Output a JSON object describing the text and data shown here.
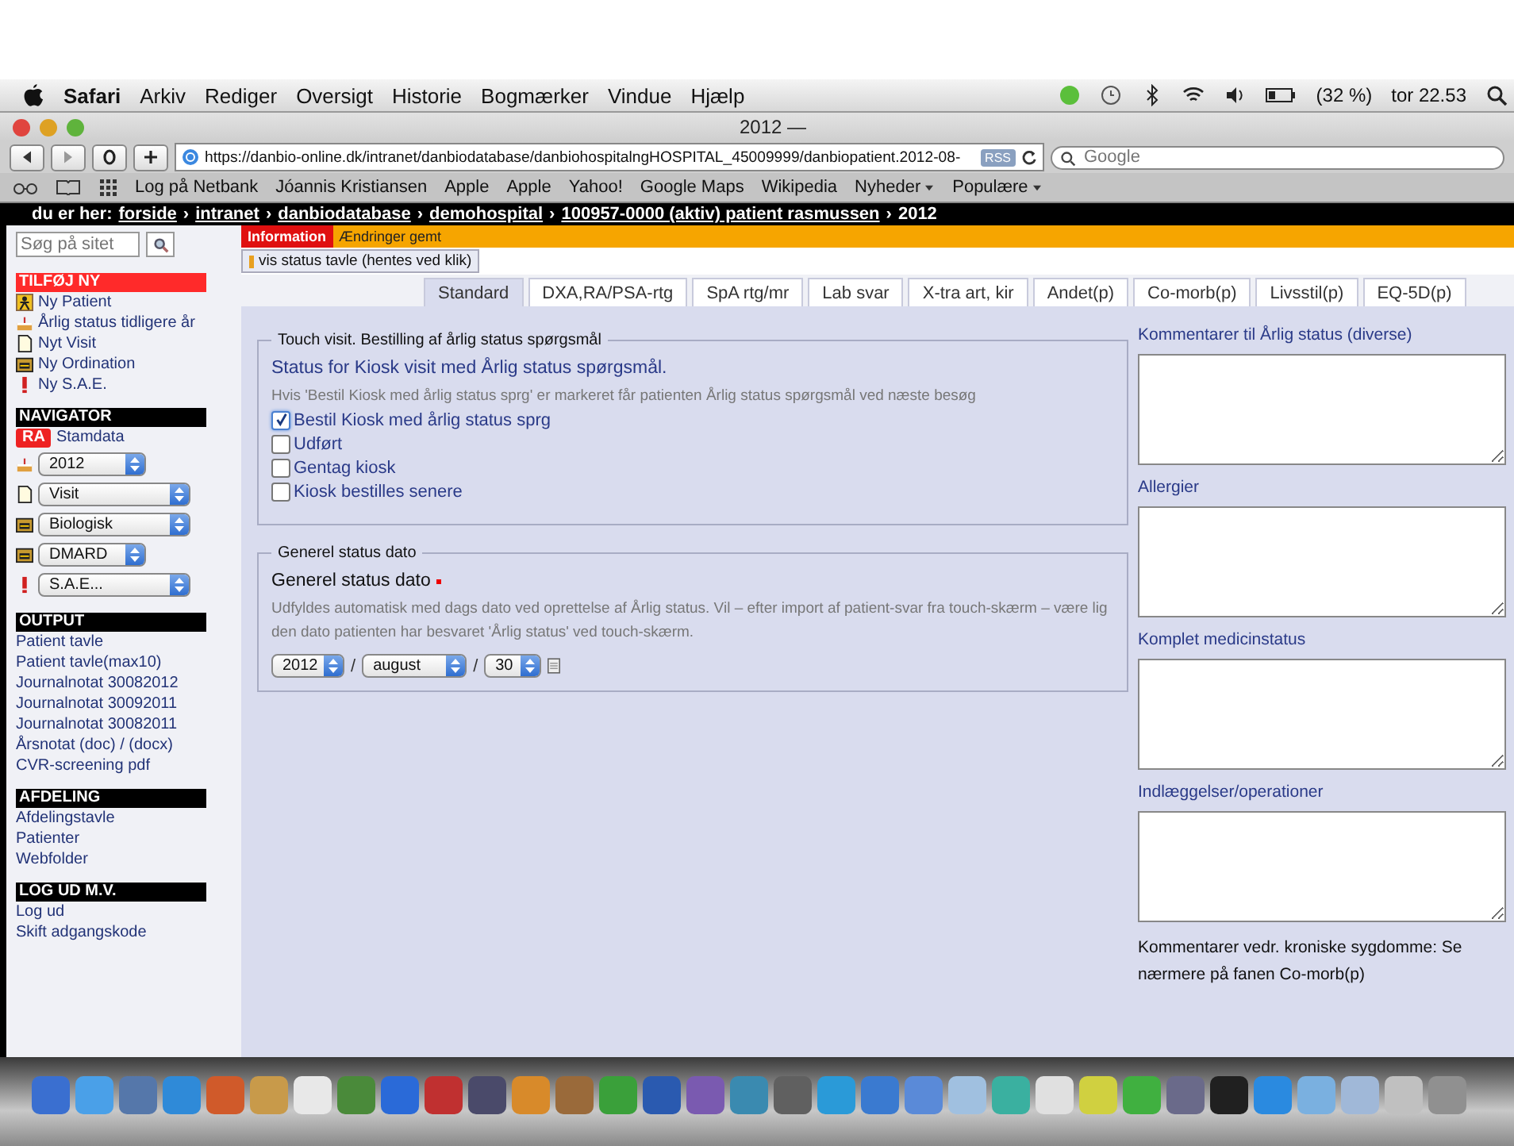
{
  "menu_bar": {
    "app": "Safari",
    "items": [
      "Arkiv",
      "Rediger",
      "Oversigt",
      "Historie",
      "Bogmærker",
      "Vindue",
      "Hjælp"
    ],
    "battery": "(32 %)",
    "clock": "tor 22.53"
  },
  "browser": {
    "title": "2012 —",
    "url": "https://danbio-online.dk/intranet/danbiodatabase/danbiohospitalngHOSPITAL_45009999/danbiopatient.2012-08-",
    "rss": "RSS",
    "search_placeholder": "Google",
    "bookmarks": [
      {
        "label": "Log på Netbank",
        "dropdown": false
      },
      {
        "label": "Jóannis Kristiansen",
        "dropdown": false
      },
      {
        "label": "Apple",
        "dropdown": false
      },
      {
        "label": "Apple",
        "dropdown": false
      },
      {
        "label": "Yahoo!",
        "dropdown": false
      },
      {
        "label": "Google Maps",
        "dropdown": false
      },
      {
        "label": "Wikipedia",
        "dropdown": false
      },
      {
        "label": "Nyheder",
        "dropdown": true
      },
      {
        "label": "Populære",
        "dropdown": true
      }
    ]
  },
  "breadcrumb": {
    "prefix": "du er her:",
    "separator": "›",
    "links": [
      "forside",
      "intranet",
      "danbiodatabase",
      "demohospital",
      "100957-0000 (aktiv) patient rasmussen"
    ],
    "current": "2012"
  },
  "sidebar": {
    "search_placeholder": "Søg på sitet",
    "sections": [
      {
        "title": "TILFØJ NY",
        "color": "#ff2a2a",
        "items": [
          {
            "kind": "person",
            "label": "Ny Patient"
          },
          {
            "kind": "cake",
            "label": "Årlig status tidligere år"
          },
          {
            "kind": "page",
            "label": "Nyt Visit"
          },
          {
            "kind": "folder",
            "label": "Ny Ordination"
          },
          {
            "kind": "alert",
            "label": "Ny S.A.E."
          }
        ]
      },
      {
        "title": "NAVIGATOR",
        "color": "#000000",
        "items": [
          {
            "kind": "badge",
            "badge": "RA",
            "label": "Stamdata"
          },
          {
            "kind": "cake",
            "select": "2012"
          },
          {
            "kind": "page",
            "select": "Visit"
          },
          {
            "kind": "folder",
            "select": "Biologisk"
          },
          {
            "kind": "folder",
            "select": "DMARD"
          },
          {
            "kind": "alert",
            "select": "S.A.E..."
          }
        ]
      },
      {
        "title": "OUTPUT",
        "color": "#000000",
        "items": [
          {
            "kind": "link",
            "label": "Patient tavle"
          },
          {
            "kind": "link",
            "label": "Patient tavle(max10)"
          },
          {
            "kind": "link",
            "label": "Journalnotat 30082012"
          },
          {
            "kind": "link",
            "label": "Journalnotat 30092011"
          },
          {
            "kind": "link",
            "label": "Journalnotat 30082011"
          },
          {
            "kind": "link",
            "label": "Årsnotat (doc) / (docx)"
          },
          {
            "kind": "link",
            "label": "CVR-screening pdf"
          }
        ]
      },
      {
        "title": "AFDELING",
        "color": "#000000",
        "items": [
          {
            "kind": "link",
            "label": "Afdelingstavle"
          },
          {
            "kind": "link",
            "label": "Patienter"
          },
          {
            "kind": "link",
            "label": "Webfolder"
          }
        ]
      },
      {
        "title": "LOG UD M.V.",
        "color": "#000000",
        "items": [
          {
            "kind": "link",
            "label": "Log ud"
          },
          {
            "kind": "link",
            "label": "Skift adgangskode"
          }
        ]
      }
    ]
  },
  "info_bar": {
    "label": "Information",
    "message": "Ændringer gemt"
  },
  "status_button": "vis status tavle (hentes ved klik)",
  "tabs": [
    {
      "label": "Standard",
      "selected": true
    },
    {
      "label": "DXA,RA/PSA-rtg",
      "selected": false
    },
    {
      "label": "SpA rtg/mr",
      "selected": false
    },
    {
      "label": "Lab svar",
      "selected": false
    },
    {
      "label": "X-tra art, kir",
      "selected": false
    },
    {
      "label": "Andet(p)",
      "selected": false
    },
    {
      "label": "Co-morb(p)",
      "selected": false
    },
    {
      "label": "Livsstil(p)",
      "selected": false
    },
    {
      "label": "EQ-5D(p)",
      "selected": false
    }
  ],
  "touch_fieldset": {
    "legend": "Touch visit. Bestilling af årlig status spørgsmål",
    "heading": "Status for Kiosk visit med Årlig status spørgsmål.",
    "help": "Hvis 'Bestil Kiosk med årlig status sprg' er markeret får patienten Årlig status spørgsmål ved næste besøg",
    "checkboxes": [
      {
        "label": "Bestil Kiosk med årlig status sprg",
        "checked": true
      },
      {
        "label": "Udført",
        "checked": false
      },
      {
        "label": "Gentag kiosk",
        "checked": false
      },
      {
        "label": "Kiosk bestilles senere",
        "checked": false
      }
    ]
  },
  "date_fieldset": {
    "legend": "Generel status dato",
    "heading": "Generel status dato",
    "required": true,
    "help": "Udfyldes automatisk med dags dato ved oprettelse af Årlig status. Vil – efter import af patient-svar fra touch-skærm – være lig den dato patienten har besvaret 'Årlig status' ved touch-skærm.",
    "year": "2012",
    "month": "august",
    "day": "30",
    "separator": "/"
  },
  "comment_fields": [
    {
      "label": "Kommentarer til Årlig status (diverse)"
    },
    {
      "label": "Allergier"
    },
    {
      "label": "Komplet medicinstatus"
    },
    {
      "label": "Indlæggelser/operationer"
    }
  ],
  "note": "Kommentarer vedr. kroniske sygdomme: Se nærmere på fanen Co-morb(p)"
}
